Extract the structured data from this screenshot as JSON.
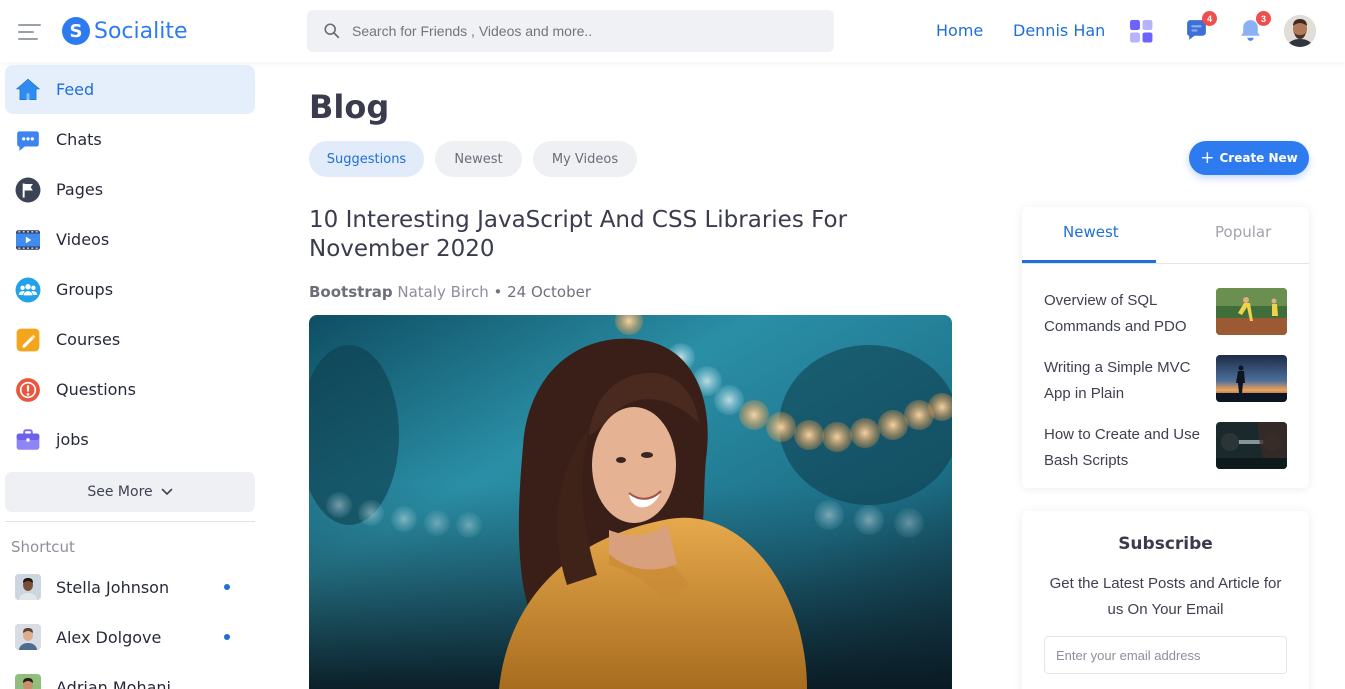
{
  "brand": {
    "name": "Socialite",
    "mark": "S",
    "color": "#2e7bf0"
  },
  "header": {
    "search_placeholder": "Search for Friends , Videos and more..",
    "links": [
      "Home",
      "Dennis Han"
    ],
    "message_count": "4",
    "notification_count": "3"
  },
  "sidebar": {
    "items": [
      {
        "label": "Feed",
        "icon": "home-icon"
      },
      {
        "label": "Chats",
        "icon": "chat-icon"
      },
      {
        "label": "Pages",
        "icon": "flag-icon"
      },
      {
        "label": "Videos",
        "icon": "video-icon"
      },
      {
        "label": "Groups",
        "icon": "groups-icon"
      },
      {
        "label": "Courses",
        "icon": "courses-icon"
      },
      {
        "label": "Questions",
        "icon": "question-icon"
      },
      {
        "label": "jobs",
        "icon": "briefcase-icon"
      }
    ],
    "see_more": "See More",
    "shortcut_title": "Shortcut",
    "contacts": [
      {
        "name": "Stella Johnson",
        "online": true
      },
      {
        "name": "Alex Dolgove",
        "online": true
      },
      {
        "name": "Adrian Mohani",
        "online": false
      }
    ]
  },
  "main": {
    "title": "Blog",
    "tabs": [
      "Suggestions",
      "Newest",
      "My Videos"
    ],
    "create_label": "Create New",
    "post": {
      "title": "10 Interesting JavaScript And CSS Libraries For November 2020",
      "category": "Bootstrap",
      "author": "Nataly Birch",
      "date": "• 24 October"
    }
  },
  "articles_card": {
    "tabs": [
      "Newest",
      "Popular"
    ],
    "articles": [
      {
        "title": "Overview of SQL Commands and PDO"
      },
      {
        "title": "Writing a Simple MVC App in Plain"
      },
      {
        "title": "How to Create and Use Bash Scripts"
      }
    ]
  },
  "subscribe": {
    "title": "Subscribe",
    "text": "Get the Latest Posts and Article for us On Your Email",
    "placeholder": "Enter your email address"
  }
}
